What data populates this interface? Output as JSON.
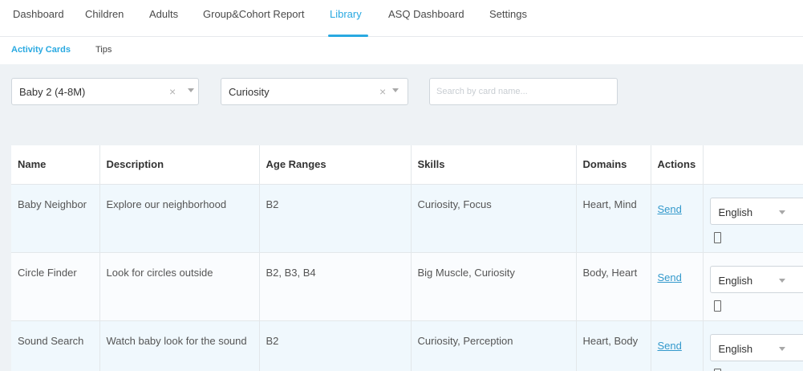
{
  "nav": {
    "tabs": [
      {
        "label": "Dashboard"
      },
      {
        "label": "Children"
      },
      {
        "label": "Adults"
      },
      {
        "label": "Group&Cohort Report"
      },
      {
        "label": "Library"
      },
      {
        "label": "ASQ Dashboard"
      },
      {
        "label": "Settings"
      }
    ],
    "active": "Library"
  },
  "subnav": {
    "tabs": [
      {
        "label": "Activity Cards"
      },
      {
        "label": "Tips"
      }
    ],
    "active": "Activity Cards"
  },
  "filters": {
    "age_select": {
      "value": "Baby 2 (4-8M)"
    },
    "skill_select": {
      "value": "Curiosity"
    },
    "search": {
      "placeholder": "Search by card name...",
      "value": ""
    }
  },
  "table": {
    "headers": [
      "Name",
      "Description",
      "Age Ranges",
      "Skills",
      "Domains",
      "Actions"
    ],
    "rows": [
      {
        "name": "Baby Neighbor",
        "description": "Explore our neighborhood",
        "age_ranges": "B2",
        "skills": "Curiosity, Focus",
        "domains": "Heart, Mind",
        "action": "Send",
        "language": "English"
      },
      {
        "name": "Circle Finder",
        "description": "Look for circles outside",
        "age_ranges": "B2, B3, B4",
        "skills": "Big Muscle, Curiosity",
        "domains": "Body, Heart",
        "action": "Send",
        "language": "English"
      },
      {
        "name": "Sound Search",
        "description": "Watch baby look for the sound",
        "age_ranges": "B2",
        "skills": "Curiosity, Perception",
        "domains": "Heart, Body",
        "action": "Send",
        "language": "English"
      }
    ]
  },
  "colors": {
    "accent": "#29a9e1",
    "link": "#3399cc",
    "panel_bg": "#eef2f5",
    "row_highlight": "#f0f8fd"
  },
  "icons": {
    "clear": "close-icon",
    "dropdown": "chevron-down-icon",
    "document": "document-icon"
  }
}
